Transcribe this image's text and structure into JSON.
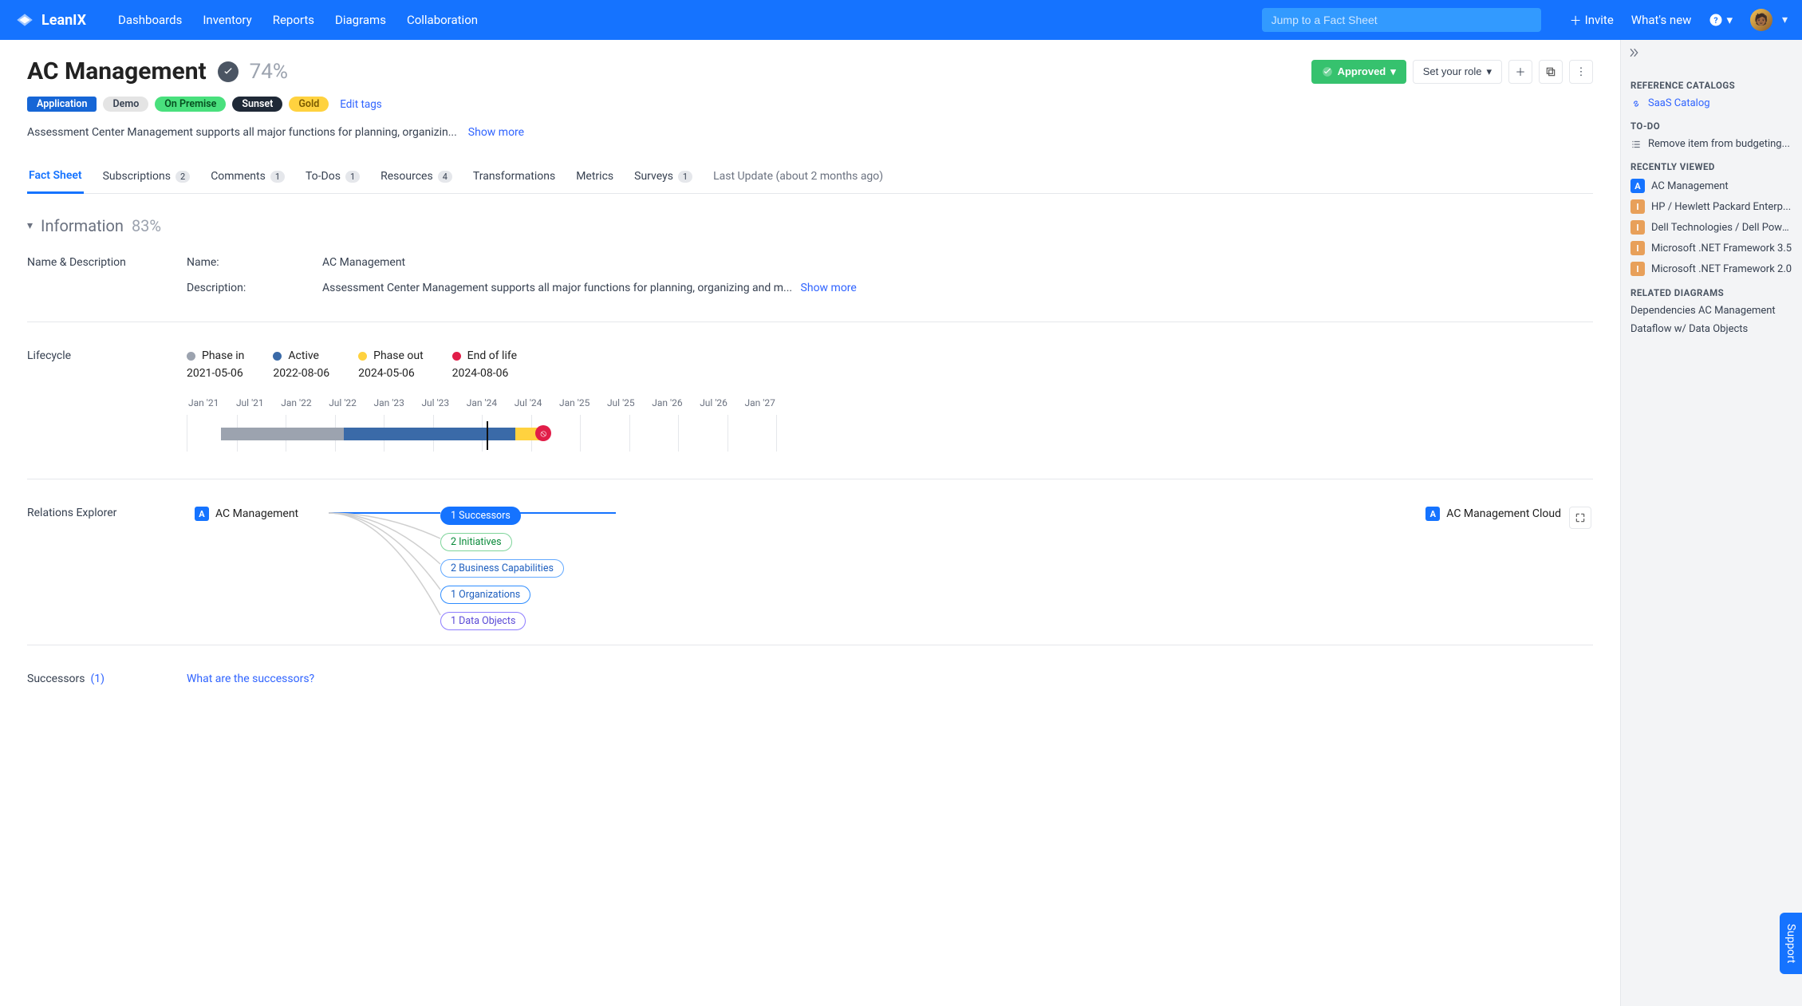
{
  "nav": {
    "brand": "LeanIX",
    "links": [
      "Dashboards",
      "Inventory",
      "Reports",
      "Diagrams",
      "Collaboration"
    ],
    "search_placeholder": "Jump to a Fact Sheet",
    "invite": "Invite",
    "whats_new": "What's new"
  },
  "header": {
    "title": "AC Management",
    "completion": "74%",
    "approved": "Approved",
    "set_role": "Set your role",
    "tags": {
      "type": "Application",
      "items": [
        "Demo",
        "On Premise",
        "Sunset",
        "Gold"
      ],
      "edit": "Edit tags"
    },
    "description": "Assessment Center Management supports all major functions for planning, organizin...",
    "show_more": "Show more"
  },
  "tabs": {
    "items": [
      {
        "label": "Fact Sheet"
      },
      {
        "label": "Subscriptions",
        "count": "2"
      },
      {
        "label": "Comments",
        "count": "1"
      },
      {
        "label": "To-Dos",
        "count": "1"
      },
      {
        "label": "Resources",
        "count": "4"
      },
      {
        "label": "Transformations"
      },
      {
        "label": "Metrics"
      },
      {
        "label": "Surveys",
        "count": "1"
      }
    ],
    "last_update": "Last Update (about 2 months ago)"
  },
  "info": {
    "section": "Information",
    "pct": "83%",
    "name_desc_label": "Name & Description",
    "name_label": "Name:",
    "name_value": "AC Management",
    "desc_label": "Description:",
    "desc_value": "Assessment Center Management supports all major functions for planning, organizing and m...",
    "show_more": "Show more"
  },
  "lifecycle": {
    "label": "Lifecycle",
    "phases": [
      {
        "name": "Phase in",
        "date": "2021-05-06",
        "color": "#9ca3af"
      },
      {
        "name": "Active",
        "date": "2022-08-06",
        "color": "#3a6aa8"
      },
      {
        "name": "Phase out",
        "date": "2024-05-06",
        "color": "#ffd23f"
      },
      {
        "name": "End of life",
        "date": "2024-08-06",
        "color": "#e11d48"
      }
    ],
    "ticks": [
      "Jan '21",
      "Jul '21",
      "Jan '22",
      "Jul '22",
      "Jan '23",
      "Jul '23",
      "Jan '24",
      "Jul '24",
      "Jan '25",
      "Jul '25",
      "Jan '26",
      "Jul '26",
      "Jan '27"
    ]
  },
  "relations": {
    "label": "Relations Explorer",
    "source": "AC Management",
    "target": "AC Management Cloud",
    "chips": [
      {
        "cls": "succ",
        "label": "1 Successors"
      },
      {
        "cls": "init",
        "label": "2 Initiatives"
      },
      {
        "cls": "bc",
        "label": "2 Business Capabilities"
      },
      {
        "cls": "org",
        "label": "1 Organizations"
      },
      {
        "cls": "do",
        "label": "1 Data Objects"
      }
    ]
  },
  "successors": {
    "label": "Successors",
    "count": "(1)",
    "question": "What are the successors?"
  },
  "side": {
    "ref_title": "REFERENCE CATALOGS",
    "saas": "SaaS Catalog",
    "todo_title": "TO-DO",
    "todo_item": "Remove item from budgeting...",
    "recent_title": "RECENTLY VIEWED",
    "recent": [
      {
        "t": "A",
        "label": "AC Management"
      },
      {
        "t": "I",
        "label": "HP / Hewlett Packard Enterp..."
      },
      {
        "t": "I",
        "label": "Dell Technologies / Dell Powe..."
      },
      {
        "t": "I",
        "label": "Microsoft .NET Framework 3.5"
      },
      {
        "t": "I",
        "label": "Microsoft .NET Framework 2.0"
      }
    ],
    "diag_title": "RELATED DIAGRAMS",
    "diagrams": [
      "Dependencies AC Management",
      "Dataflow w/ Data Objects"
    ]
  },
  "support": "Support"
}
